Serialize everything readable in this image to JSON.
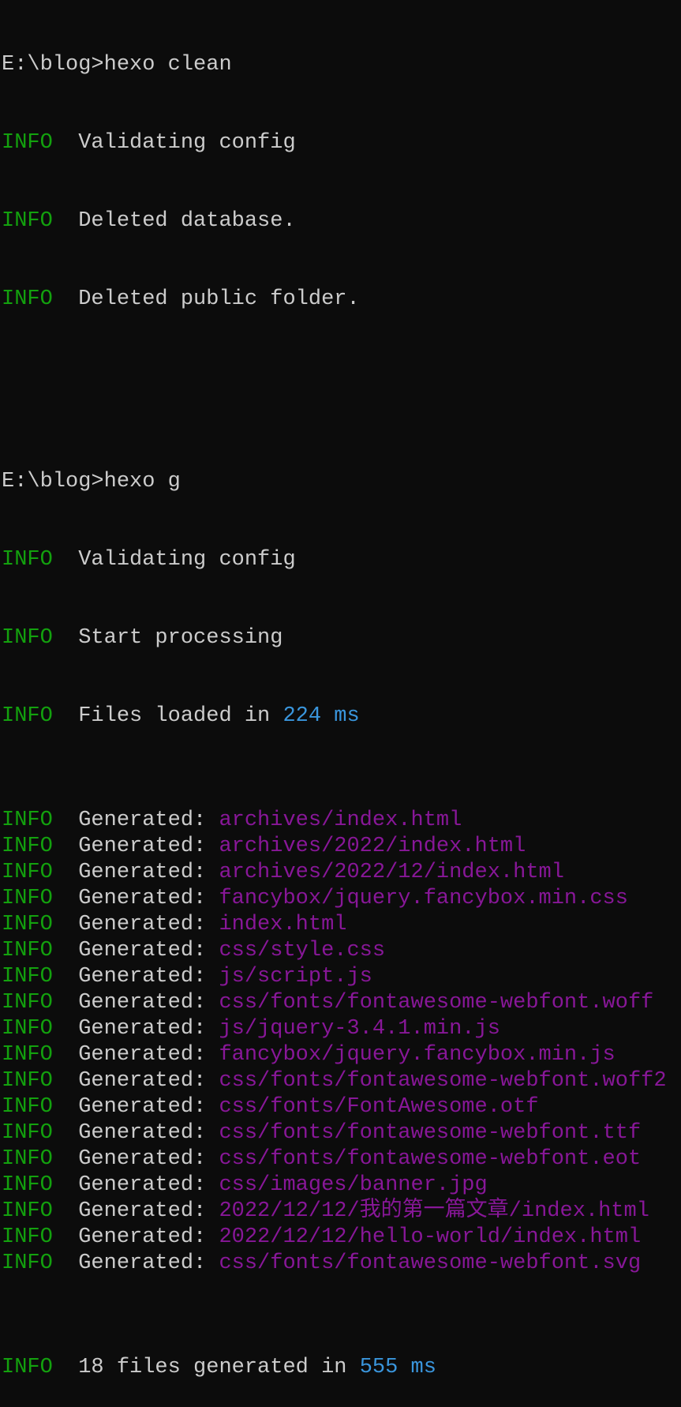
{
  "session1": {
    "prompt": "E:\\blog>hexo clean",
    "lines": [
      {
        "level": "INFO",
        "msg": "Validating config"
      },
      {
        "level": "INFO",
        "msg": "Deleted database."
      },
      {
        "level": "INFO",
        "msg": "Deleted public folder."
      }
    ]
  },
  "session2": {
    "prompt": "E:\\blog>hexo g",
    "validating": {
      "level": "INFO",
      "msg": "Validating config"
    },
    "start": {
      "level": "INFO",
      "msg": "Start processing"
    },
    "loaded": {
      "level": "INFO",
      "msg": "Files loaded in ",
      "value": "224 ms"
    },
    "generated_label": "Generated: ",
    "generated": [
      "archives/index.html",
      "archives/2022/index.html",
      "archives/2022/12/index.html",
      "fancybox/jquery.fancybox.min.css",
      "index.html",
      "css/style.css",
      "js/script.js",
      "css/fonts/fontawesome-webfont.woff",
      "js/jquery-3.4.1.min.js",
      "fancybox/jquery.fancybox.min.js",
      "css/fonts/fontawesome-webfont.woff2",
      "css/fonts/FontAwesome.otf",
      "css/fonts/fontawesome-webfont.ttf",
      "css/fonts/fontawesome-webfont.eot",
      "css/images/banner.jpg",
      "2022/12/12/我的第一篇文章/index.html",
      "2022/12/12/hello-world/index.html",
      "css/fonts/fontawesome-webfont.svg"
    ],
    "summary": {
      "level": "INFO",
      "msg": "18 files generated in ",
      "value": "555 ms"
    }
  },
  "colors": {
    "background": "#0c0c0c",
    "text": "#cccccc",
    "info": "#13a10e",
    "number": "#3a96dd",
    "path": "#881798"
  }
}
